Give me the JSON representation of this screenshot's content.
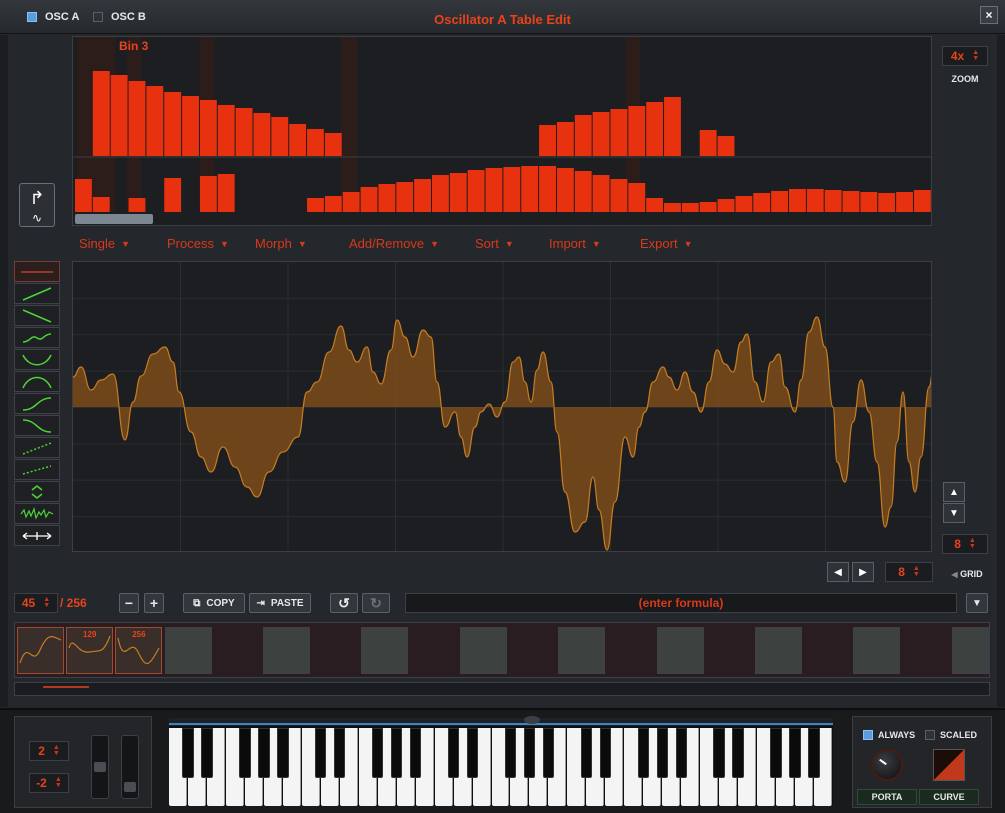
{
  "window": {
    "title": "Oscillator A Table Edit",
    "close_label": "×",
    "osc_a_label": "OSC A",
    "osc_b_label": "OSC B"
  },
  "spectrum": {
    "bin_label": "Bin 3",
    "zoom_value": "4x",
    "zoom_label": "ZOOM"
  },
  "menus": [
    {
      "label": "Single",
      "arrow": "▼"
    },
    {
      "label": "Process",
      "arrow": "▼"
    },
    {
      "label": "Morph",
      "arrow": "▼"
    },
    {
      "label": "Add/Remove",
      "arrow": "▼"
    },
    {
      "label": "Sort",
      "arrow": "▼"
    },
    {
      "label": "Import",
      "arrow": "▼"
    },
    {
      "label": "Export",
      "arrow": "▼"
    }
  ],
  "grid": {
    "value": "8",
    "label": "GRID",
    "step_value": "8"
  },
  "toolbar": {
    "frame_index": "45",
    "frame_total": "/ 256",
    "minus": "−",
    "plus": "+",
    "copy_label": "COPY",
    "paste_label": "PASTE",
    "formula_placeholder": "(enter formula)"
  },
  "frames": [
    {
      "num": ""
    },
    {
      "num": "129"
    },
    {
      "num": "256"
    }
  ],
  "keyboard_panel": {
    "octave_up": "2",
    "octave_down": "-2",
    "always_label": "ALWAYS",
    "scaled_label": "SCALED",
    "porta_label": "PORTA",
    "curve_label": "CURVE"
  },
  "colors": {
    "accent": "#e8431a",
    "wave": "#b8701e",
    "bars": "#e8320f"
  }
}
